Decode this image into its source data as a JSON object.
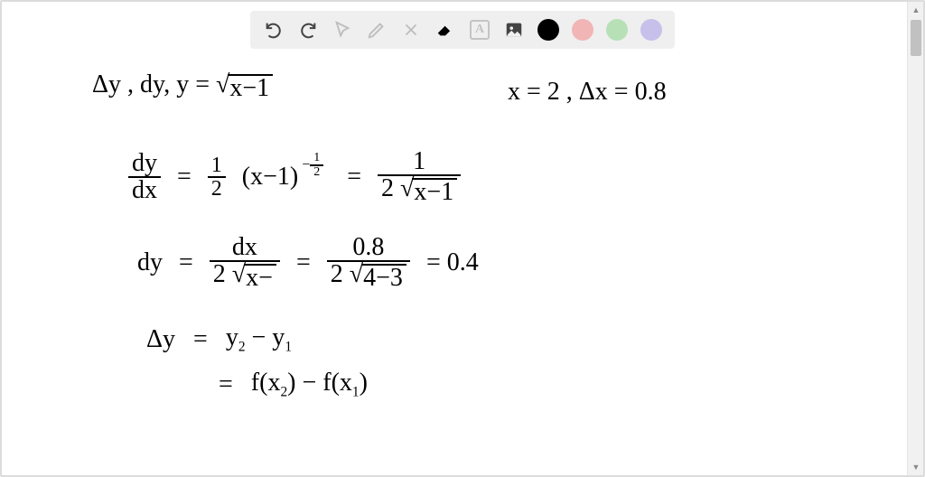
{
  "toolbar": {
    "text_tool_label": "A",
    "colors": {
      "black": "#000000",
      "pink": "#f1b5b5",
      "green": "#b7e0b7",
      "purple": "#c7c0ea"
    }
  },
  "math": {
    "line1_left": "Δy  ,  dy,    y =",
    "line1_radicand": "x−1",
    "line1_right": "x = 2 ,  Δx = 0.8",
    "line2_lhs_num": "dy",
    "line2_lhs_den": "dx",
    "line2_eq1": "=",
    "line2_half_num": "1",
    "line2_half_den": "2",
    "line2_mid": "(x−1)",
    "line2_exp_num": "1",
    "line2_exp_den": "2",
    "line2_exp_neg": "−",
    "line2_eq2": "=",
    "line2_r_num": "1",
    "line2_r_den_pre": "2",
    "line2_r_den_rad": "x−1",
    "line3_lhs": "dy",
    "line3_eq1": "=",
    "line3_m_num": "dx",
    "line3_m_den_pre": "2",
    "line3_m_den_rad": "x−",
    "line3_eq2": "=",
    "line3_r_num": "0.8",
    "line3_r_den_pre": "2",
    "line3_r_den_rad": "4−3",
    "line3_eq3": "= 0.4",
    "line4_lhs": "Δy",
    "line4_eq": "=",
    "line4_rhs_pre": "y",
    "line4_sub2": "2",
    "line4_minus": "− y",
    "line4_sub1": "1",
    "line5_eq": "=",
    "line5_rhs": "f(x",
    "line5_sub2": "2",
    "line5_mid": ") − f(x",
    "line5_sub1": "1",
    "line5_close": ")"
  }
}
